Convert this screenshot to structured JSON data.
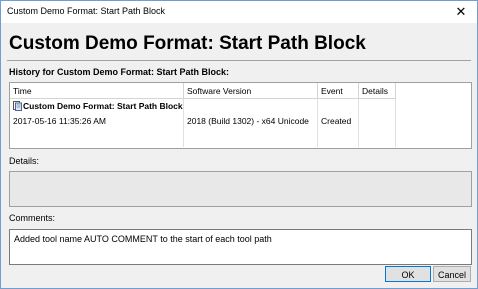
{
  "window": {
    "title": "Custom Demo Format: Start Path Block",
    "close_glyph": "✕"
  },
  "header": {
    "title": "Custom Demo Format: Start Path Block"
  },
  "history": {
    "label": "History for Custom Demo Format: Start Path Block:",
    "columns": [
      "Time",
      "Software Version",
      "Event",
      "Details"
    ],
    "group": "Custom Demo Format: Start Path Block",
    "rows": [
      {
        "time": "2017-05-16 11:35:26 AM",
        "version": "2018 (Build 1302) - x64 Unicode",
        "event": "Created",
        "details": ""
      }
    ]
  },
  "details": {
    "label": "Details:",
    "value": ""
  },
  "comments": {
    "label": "Comments:",
    "value": "Added tool name AUTO COMMENT to the start of each tool path"
  },
  "buttons": {
    "ok": "OK",
    "cancel": "Cancel"
  }
}
